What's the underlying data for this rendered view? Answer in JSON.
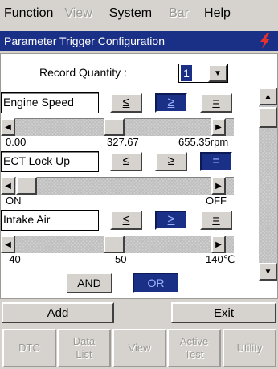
{
  "menubar": {
    "items": [
      {
        "label": "Function",
        "enabled": true
      },
      {
        "label": "View",
        "enabled": false
      },
      {
        "label": "System",
        "enabled": true
      },
      {
        "label": "Bar",
        "enabled": false
      },
      {
        "label": "Help",
        "enabled": true
      }
    ]
  },
  "title": "Parameter Trigger Configuration",
  "record_quantity": {
    "label": "Record Quantity :",
    "value": "1"
  },
  "params": [
    {
      "name": "Engine Speed",
      "operators": [
        "≤",
        "≥",
        "="
      ],
      "active_operator": 1,
      "slider_fraction": 0.5,
      "ticks": [
        "0.00",
        "327.67",
        "655.35rpm"
      ]
    },
    {
      "name": "ECT Lock Up",
      "operators": [
        "≤",
        "≥",
        "="
      ],
      "active_operator": 2,
      "slider_fraction": 0.0,
      "ticks": [
        "ON",
        "",
        "OFF"
      ]
    },
    {
      "name": "Intake Air",
      "operators": [
        "≤",
        "≥",
        "="
      ],
      "active_operator": 1,
      "slider_fraction": 0.5,
      "ticks": [
        "-40",
        "50",
        "140℃"
      ]
    }
  ],
  "logic": {
    "and_label": "AND",
    "or_label": "OR",
    "active": "OR"
  },
  "actions": {
    "add_label": "Add",
    "exit_label": "Exit"
  },
  "nav": [
    {
      "label": "DTC"
    },
    {
      "label": "Data\nList"
    },
    {
      "label": "View"
    },
    {
      "label": "Active\nTest"
    },
    {
      "label": "Utility"
    }
  ],
  "colors": {
    "accent": "#1a2f86",
    "disabled_text": "#9c9a94",
    "panel_bg": "#ffffff",
    "chrome_bg": "#d6d3ce"
  }
}
